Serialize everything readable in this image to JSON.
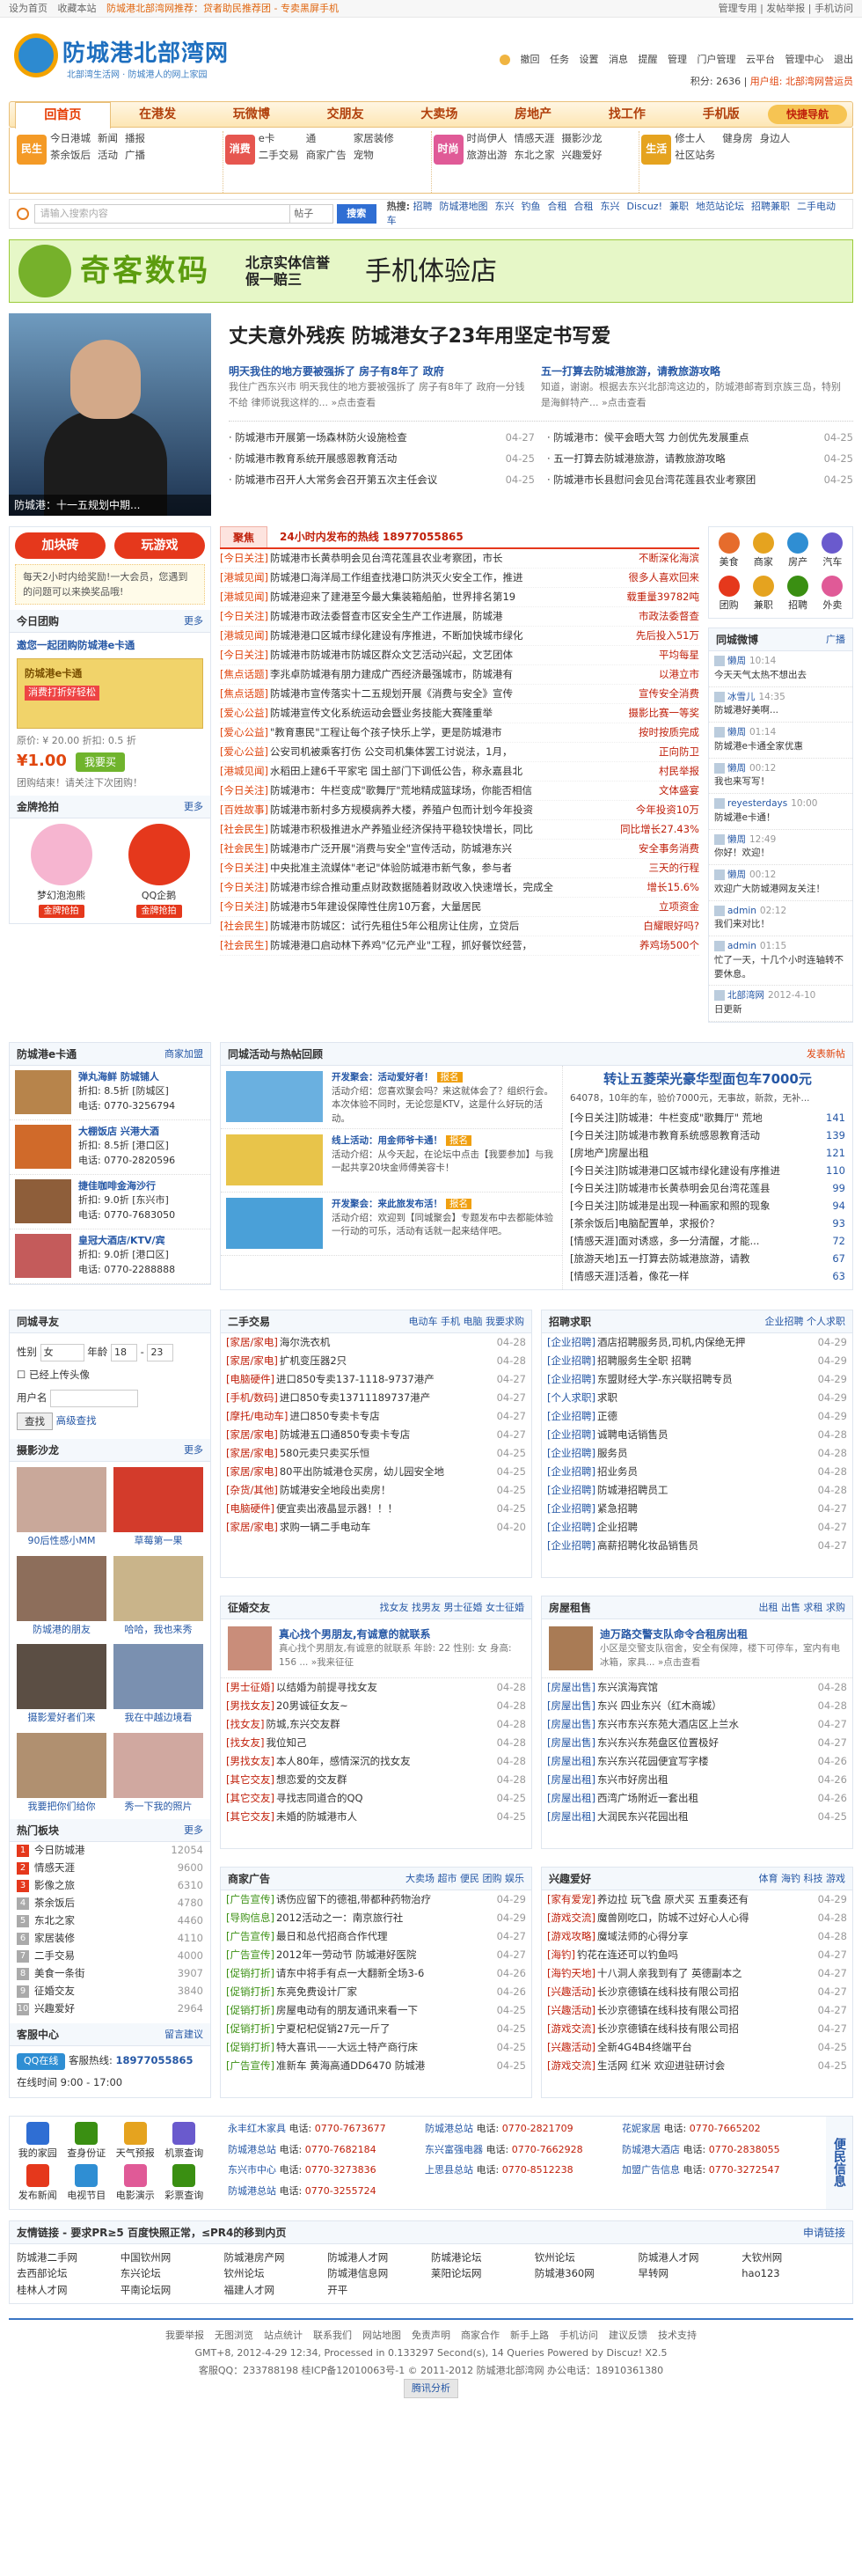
{
  "topbar": {
    "left": [
      "设为首页",
      "收藏本站"
    ],
    "notice": "防城港北部湾网推荐：贷者助民推荐团 - 专卖黑屏手机",
    "right": [
      "管理专用",
      "发帖举报",
      "手机访问"
    ]
  },
  "site": {
    "name": "防城港北部湾网",
    "slogan": "北部湾生活网 · 防城港人的网上家园"
  },
  "user": {
    "links": [
      "撤回",
      "任务",
      "设置",
      "消息",
      "提醒",
      "管理",
      "门户管理",
      "云平台",
      "管理中心",
      "退出"
    ],
    "score": "积分: 2636",
    "group": "用户组: 北部湾网营运员",
    "name": "撤回"
  },
  "nav": {
    "items": [
      "回首页",
      "在港发",
      "玩微博",
      "交朋友",
      "大卖场",
      "房地产",
      "找工作",
      "手机版"
    ],
    "right": "快捷导航"
  },
  "subnav": [
    {
      "icon": "民生",
      "color": "#f49a26",
      "links": [
        "今日港城",
        "新闻",
        "播报",
        "茶余饭后",
        "活动",
        "广播"
      ]
    },
    {
      "icon": "消费",
      "color": "#e6564f",
      "links": [
        "e卡",
        "通",
        "家居装修",
        "二手交易",
        "商家广告",
        "宠物"
      ]
    },
    {
      "icon": "时尚",
      "color": "#e05a97",
      "links": [
        "时尚伊人",
        "情感天涯",
        "摄影沙龙",
        "旅游出游",
        "东北之家",
        "兴趣爱好"
      ]
    },
    {
      "icon": "生活",
      "color": "#e5a31f",
      "links": [
        "修士人",
        "健身房",
        "身边人",
        "社区站务"
      ]
    }
  ],
  "search": {
    "placeholder": "请输入搜索内容",
    "scope": "帖子",
    "button": "搜索",
    "hotLabel": "热搜:",
    "hot": [
      "招聘",
      "防城港地图",
      "东兴",
      "钓鱼",
      "合租",
      "合租",
      "东兴",
      "Discuz!",
      "兼职",
      "地范站论坛",
      "招聘兼职",
      "二手电动车"
    ]
  },
  "banner": {
    "brand": "奇客数码",
    "mid1": "北京实体信誉",
    "mid2": "假一赔三",
    "right": "手机体验店"
  },
  "headline": {
    "caption": "防城港：十一五规划中期...",
    "title": "丈夫意外残疾 防城港女子23年用坚定书写爱",
    "p1t": "明天我住的地方要被强拆了 房子有8年了 政府",
    "p1": "我住广西东兴市 明天我住的地方要被强拆了 房子有8年了 政府一分钱不给 律师说我这样的... »点击查看",
    "p2t": "五一打算去防城港旅游，请教旅游攻略",
    "p2": "知道，谢谢。根据去东兴北部湾这边的，防城港邮寄到京族三岛，特别是海鲜特产... »点击查看",
    "news": [
      {
        "t": "防城港市开展第一场森林防火设施检查",
        "d": "04-27"
      },
      {
        "t": "防城港市：侯平会晤大驾 力创优先发展重点",
        "d": "04-25"
      },
      {
        "t": "防城港市教育系统开展感恩教育活动",
        "d": "04-25"
      },
      {
        "t": "五一打算去防城港旅游，请教旅游攻略",
        "d": "04-25"
      },
      {
        "t": "防城港市召开人大常务会召开第五次主任会议",
        "d": "04-25"
      },
      {
        "t": "防城港市长县慰问会见台湾花莲县农业考察团",
        "d": "04-25"
      }
    ]
  },
  "left": {
    "buttons": [
      "加块砖",
      "玩游戏"
    ],
    "notice": "每天2小时内给奖励!一大会员，您遇到的问题可以来换奖品哦!",
    "tgTitle": "今日团购",
    "tgItem": "邀您一起团购防城港e卡通",
    "tgCard": "防城港e卡通",
    "tgBadge": "消费打折好轻松",
    "tgPrice": "¥1.00",
    "tgOrig": "原价: ¥ 20.00  折扣: 0.5 折",
    "tgBuy": "我要买",
    "tgNote": "团购结束！请关注下次团购！",
    "giftTitle": "金牌抢拍",
    "gifts": [
      {
        "name": "梦幻泡泡熊",
        "btn": "金牌抢拍"
      },
      {
        "name": "QQ企鹅",
        "btn": "金牌抢拍"
      }
    ]
  },
  "center": {
    "tabs": [
      "聚焦",
      "24小时内发布的热线 18977055865"
    ],
    "list": [
      {
        "tag": "[今日关注]",
        "t": "防城港市长黄恭明会见台湾花莲县农业考察团，市长",
        "r": "不断深化海滨"
      },
      {
        "tag": "[港城见闻]",
        "t": "防城港口海洋局工作组查找港口防洪灭火安全工作，推进",
        "r": "很多人喜欢回来"
      },
      {
        "tag": "[港城见闻]",
        "t": "防城港迎来了建港至今最大集装箱船舶，世界排名第19",
        "r": "载重量39782吨"
      },
      {
        "tag": "[今日关注]",
        "t": "防城港市政法委督查市区安全生产工作进展，防城港",
        "r": "市政法委督查"
      },
      {
        "tag": "[港城见闻]",
        "t": "防城港港口区城市绿化建设有序推进，不断加快城市绿化",
        "r": "先后投入51万"
      },
      {
        "tag": "[今日关注]",
        "t": "防城港市防城港市防城区群众文艺活动兴起，文艺团体",
        "r": "平均每星"
      },
      {
        "tag": "[焦点话题]",
        "t": "李兆卓防城港有朋力建成广西经济最强城市，防城港有",
        "r": "以港立市"
      },
      {
        "tag": "[焦点话题]",
        "t": "防城港市宣传落实十二五规划开展《消费与安全》宣传",
        "r": "宣传安全消费"
      },
      {
        "tag": "[爱心公益]",
        "t": "防城港宣传文化系统运动会暨业务技能大赛隆重举",
        "r": "摄影比赛一等奖"
      },
      {
        "tag": "[爱心公益]",
        "t": "\"教育惠民\"工程让每个孩子快乐上学，更是防城港市",
        "r": "按时按质完成"
      },
      {
        "tag": "[爱心公益]",
        "t": "公安司机被乘客打伤 公交司机集体罢工讨说法，1月，",
        "r": "正向防卫"
      },
      {
        "tag": "[港城见闻]",
        "t": "水稻田上建6千平家宅 国土部门下调低公告，称永嘉县北",
        "r": "村民举报"
      },
      {
        "tag": "[今日关注]",
        "t": "防城港市：牛栏变成\"歌舞厅\"荒地精成篮球场，你能否相信",
        "r": "文体盛宴"
      },
      {
        "tag": "[百姓故事]",
        "t": "防城港市新村多方规模病养大楼，养殖户包而计划今年投资",
        "r": "今年投资10万"
      },
      {
        "tag": "[社会民生]",
        "t": "防城港市积极推进水产养殖业经济保持平稳较快增长，同比",
        "r": "同比增长27.43%"
      },
      {
        "tag": "[社会民生]",
        "t": "防城港市广泛开展\"消费与安全\"宣传活动，防城港东兴",
        "r": "安全事务消费"
      },
      {
        "tag": "[今日关注]",
        "t": "中央批准主流媒体\"老记\"体验防城港市新气象，参与者",
        "r": "三天的行程"
      },
      {
        "tag": "[今日关注]",
        "t": "防城港市综合推动重点财政数据随着财政收入快速增长，完成全",
        "r": "增长15.6%"
      },
      {
        "tag": "[今日关注]",
        "t": "防城港市5年建设保障性住房10万套，大量居民",
        "r": "立项资金"
      },
      {
        "tag": "[社会民生]",
        "t": "防城港市防城区：试行先租住5年公租房让住房，立贷后",
        "r": "白耀眼好吗?"
      },
      {
        "tag": "[社会民生]",
        "t": "防城港港口启动林下养鸡\"亿元产业\"工程，抓好餐饮经营，",
        "r": "养鸡场500个"
      }
    ]
  },
  "right": {
    "cats": [
      "美食",
      "商家",
      "房产",
      "汽车",
      "团购",
      "兼职",
      "招聘",
      "外卖"
    ],
    "catColors": [
      "#e66c2c",
      "#e5a31f",
      "#2f8ed3",
      "#6a5acd",
      "#e5381c",
      "#e5a31f",
      "#3a8f12",
      "#e05a97"
    ],
    "feedTitle": "同城微博",
    "feedMore": "广播",
    "feed": [
      {
        "who": "懒周",
        "tm": "10:14",
        "t": "今天天气太热不想出去"
      },
      {
        "who": "冰雪儿",
        "tm": "14:35",
        "t": "防城港好美啊..."
      },
      {
        "who": "懒周",
        "tm": "01:14",
        "t": "防城港e卡通全家优惠"
      },
      {
        "who": "懒周",
        "tm": "00:12",
        "t": "我也来写写！"
      },
      {
        "who": "reyesterdays",
        "tm": "10:00",
        "t": "防城港e卡通！"
      },
      {
        "who": "懒周",
        "tm": "12:49",
        "t": "你好！欢迎！"
      },
      {
        "who": "懒周",
        "tm": "00:12",
        "t": "欢迎广大防城港网友关注！"
      },
      {
        "who": "admin",
        "tm": "02:12",
        "t": "我们来对比！"
      },
      {
        "who": "admin",
        "tm": "01:15",
        "t": "忙了一天，十几个小时连轴转不要休息。"
      },
      {
        "who": "北部湾网",
        "tm": "2012-4-10",
        "t": "日更新"
      }
    ]
  },
  "merch": {
    "title": "防城港e卡通",
    "more": "商家加盟",
    "items": [
      {
        "n": "弹丸海鲜 防城铺人",
        "d": "折扣: 8.5折 [防城区]",
        "p": "电话: 0770-3256794"
      },
      {
        "n": "大棚饭店 兴港大酒",
        "d": "折扣: 8.5折 [港口区]",
        "p": "电话: 0770-2820596"
      },
      {
        "n": "捷佳咖啡金海沙行",
        "d": "折扣: 9.0折 [东兴市]",
        "p": "电话: 0770-7683050"
      },
      {
        "n": "皇冠大酒店/KTV/宾",
        "d": "折扣: 9.0折 [港口区]",
        "p": "电话: 0770-2288888"
      }
    ]
  },
  "activity": {
    "title": "同城活动与热帖回顾",
    "more": "发表新帖",
    "items": [
      {
        "n": "开发聚会：活动爱好者！",
        "tag": "报名",
        "d": "活动介绍：您喜欢聚会吗？来这就体会了？组织行会。本次体验不同时，无论您是KTV，这是什么好玩的活动。"
      },
      {
        "n": "线上活动：用金师爷卡通！",
        "tag": "报名",
        "d": "活动介绍：从今天起，在论坛中点击【我要参加】与我一起共享20块金师傅美容卡！"
      },
      {
        "n": "开发聚会：来此旅发布活！",
        "tag": "报名",
        "d": "活动介绍：欢迎到【同城聚会】专题发布中去都能体验一行动的可乐，活动有话就一起来结伴吧。"
      }
    ],
    "hotTitle": "转让五菱荣光豪华型面包车7000元",
    "hotP": "64078，10年的车，验价7000元，无事故，新款，无补...",
    "hot": [
      {
        "t": "[今日关注]防城港：牛栏变成\"歌舞厅\" 荒地",
        "c": "141"
      },
      {
        "t": "[今日关注]防城港市教育系统感恩教育活动",
        "c": "139"
      },
      {
        "t": "[房地产]房屋出租",
        "c": "121"
      },
      {
        "t": "[今日关注]防城港港口区城市绿化建设有序推进",
        "c": "110"
      },
      {
        "t": "[今日关注]防城港市长黄恭明会见台湾花莲县",
        "c": "99"
      },
      {
        "t": "[今日关注]防城港是出现一种画家和照的现象",
        "c": "94"
      },
      {
        "t": "[茶余饭后]电脑配置单，求报价？",
        "c": "93"
      },
      {
        "t": "[情感天涯]面对诱惑，多一分清醒，才能...",
        "c": "72"
      },
      {
        "t": "[旅游天地]五一打算去防城港旅游，请教",
        "c": "67"
      },
      {
        "t": "[情感天涯]活着，像花一样",
        "c": "63"
      }
    ]
  },
  "finder": {
    "title": "同城寻友",
    "sex": "女",
    "age1": "18",
    "age2": "23",
    "photo": "已经上传头像",
    "user": "用户名",
    "btn": "查找",
    "adv": "高级查找"
  },
  "photos": {
    "title": "摄影沙龙",
    "more": "更多",
    "items": [
      "90后性感小MM",
      "草莓第一果",
      "防城港的朋友",
      "哈哈，我也来秀",
      "摄影爱好者们来",
      "我在中越边境看",
      "我要把你们给你",
      "秀一下我的照片"
    ]
  },
  "hotboard": {
    "title": "热门板块",
    "items": [
      {
        "n": "今日防城港",
        "c": "12054"
      },
      {
        "n": "情感天涯",
        "c": "9600"
      },
      {
        "n": "影像之旅",
        "c": "6310"
      },
      {
        "n": "茶余饭后",
        "c": "4780"
      },
      {
        "n": "东北之家",
        "c": "4460"
      },
      {
        "n": "家居装修",
        "c": "4110"
      },
      {
        "n": "二手交易",
        "c": "4000"
      },
      {
        "n": "美食一条街",
        "c": "3907"
      },
      {
        "n": "征婚交友",
        "c": "3840"
      },
      {
        "n": "兴趣爱好",
        "c": "2964"
      }
    ]
  },
  "ershou": {
    "title": "二手交易",
    "tabs": [
      "电动车",
      "手机",
      "电脑",
      "我要求购"
    ],
    "items": [
      {
        "tag": "[家居/家电]",
        "t": "海尔洗衣机",
        "d": "04-28"
      },
      {
        "tag": "[家居/家电]",
        "t": "扩机变压器2只",
        "d": "04-28"
      },
      {
        "tag": "[电脑硬件]",
        "t": "进口850专卖137-1118-9737港产",
        "d": "04-27"
      },
      {
        "tag": "[手机/数码]",
        "t": "进口850专卖13711189737港产",
        "d": "04-27"
      },
      {
        "tag": "[摩托/电动车]",
        "t": "进口850专卖卡专店",
        "d": "04-27"
      },
      {
        "tag": "[家居/家电]",
        "t": "防城港五口通850专卖卡专店",
        "d": "04-27"
      },
      {
        "tag": "[家居/家电]",
        "t": "580元卖只卖买乐恒",
        "d": "04-25"
      },
      {
        "tag": "[家居/家电]",
        "t": "80平出防城港仓买房，幼儿园安全地",
        "d": "04-25"
      },
      {
        "tag": "[杂货/其他]",
        "t": "防城港安全地段出卖房！",
        "d": "04-25"
      },
      {
        "tag": "[电脑硬件]",
        "t": "便宜卖出液晶显示器！！！",
        "d": "04-25"
      },
      {
        "tag": "[家居/家电]",
        "t": "求购一辆二手电动车",
        "d": "04-20"
      }
    ]
  },
  "zhaopin": {
    "title": "招聘求职",
    "tabs": [
      "企业招聘",
      "个人求职"
    ],
    "items": [
      {
        "tag": "[企业招聘]",
        "t": "酒店招聘服务员,司机,内保绝无押",
        "d": "04-29"
      },
      {
        "tag": "[企业招聘]",
        "t": "招聘服务生全职 招聘",
        "d": "04-29"
      },
      {
        "tag": "[企业招聘]",
        "t": "东盟财经大学-东兴联招聘专员",
        "d": "04-29"
      },
      {
        "tag": "[个人求职]",
        "t": "求职",
        "d": "04-29"
      },
      {
        "tag": "[企业招聘]",
        "t": "正德",
        "d": "04-29"
      },
      {
        "tag": "[企业招聘]",
        "t": "诚聘电话销售员",
        "d": "04-28"
      },
      {
        "tag": "[企业招聘]",
        "t": "服务员",
        "d": "04-28"
      },
      {
        "tag": "[企业招聘]",
        "t": "招业务员",
        "d": "04-28"
      },
      {
        "tag": "[企业招聘]",
        "t": "防城港招聘员工",
        "d": "04-28"
      },
      {
        "tag": "[企业招聘]",
        "t": "紧急招聘",
        "d": "04-27"
      },
      {
        "tag": "[企业招聘]",
        "t": "企业招聘",
        "d": "04-27"
      },
      {
        "tag": "[企业招聘]",
        "t": "高薪招聘化妆品销售员",
        "d": "04-27"
      }
    ]
  },
  "zhenghun": {
    "title": "征婚交友",
    "tabs": [
      "找女友",
      "找男友",
      "男士征婚",
      "女士征婚"
    ],
    "feat": "真心找个男朋友,有诚意的就联系",
    "featP": "真心找个男朋友,有诚意的就联系 年龄: 22 性别: 女 身高: 156 ... »我来征征",
    "items": [
      {
        "tag": "[男士征婚]",
        "t": "以结婚为前提寻找女友",
        "d": "04-28"
      },
      {
        "tag": "[男找女友]",
        "t": "20男诚征女友~",
        "d": "04-28"
      },
      {
        "tag": "[找女友]",
        "t": "防城,东兴交友群",
        "d": "04-28"
      },
      {
        "tag": "[找女友]",
        "t": "我位知己",
        "d": "04-28"
      },
      {
        "tag": "[男找女友]",
        "t": "本人80年，感情深沉的找女友",
        "d": "04-28"
      },
      {
        "tag": "[其它交友]",
        "t": "想恋爱的交友群",
        "d": "04-28"
      },
      {
        "tag": "[其它交友]",
        "t": "寻找志同道合的QQ",
        "d": "04-25"
      },
      {
        "tag": "[其它交友]",
        "t": "未婚的防城港市人",
        "d": "04-25"
      }
    ]
  },
  "fang": {
    "title": "房屋租售",
    "tabs": [
      "出租",
      "出售",
      "求租",
      "求购"
    ],
    "feat": "迪万路交警支队命令合租房出租",
    "featP": "小区是交警支队宿舍，安全有保障，楼下可停车，室内有电冰箱，家具... »点击查看",
    "items": [
      {
        "tag": "[房屋出售]",
        "t": "东兴滨海宾馆",
        "d": "04-28"
      },
      {
        "tag": "[房屋出售]",
        "t": "东兴 四业东兴（红木商城）",
        "d": "04-28"
      },
      {
        "tag": "[房屋出售]",
        "t": "东兴市东兴东苑大酒店区上兰水",
        "d": "04-27"
      },
      {
        "tag": "[房屋出售]",
        "t": "东兴东兴东苑盘区位置极好",
        "d": "04-27"
      },
      {
        "tag": "[房屋出租]",
        "t": "东兴东兴花园便宜写字楼",
        "d": "04-26"
      },
      {
        "tag": "[房屋出租]",
        "t": "东兴市好房出租",
        "d": "04-26"
      },
      {
        "tag": "[房屋出租]",
        "t": "西湾广场附近一套出租",
        "d": "04-26"
      },
      {
        "tag": "[房屋出租]",
        "t": "大润民东兴花园出租",
        "d": "04-25"
      }
    ]
  },
  "shangjia": {
    "title": "商家广告",
    "tabs": [
      "大卖场",
      "超市",
      "便民",
      "团购",
      "娱乐"
    ],
    "items": [
      {
        "tag": "[广告宣传]",
        "t": "诱伤应留下的德祖,带都种药物治疗",
        "d": "04-29"
      },
      {
        "tag": "[导购信息]",
        "t": "2012活动之一：南京旅行社",
        "d": "04-29"
      },
      {
        "tag": "[广告宣传]",
        "t": "最日和总代招商合作代理",
        "d": "04-27"
      },
      {
        "tag": "[广告宣传]",
        "t": "2012年一劳动节 防城港好医院",
        "d": "04-27"
      },
      {
        "tag": "[促销打折]",
        "t": "请东中将手有点一大翻新全场3-6",
        "d": "04-26"
      },
      {
        "tag": "[促销打折]",
        "t": "东亮免费设计厂家",
        "d": "04-26"
      },
      {
        "tag": "[促销打折]",
        "t": "房屋电动有的朋友通讯来看一下",
        "d": "04-25"
      },
      {
        "tag": "[促销打折]",
        "t": "宁夏杞杞促销27元一斤了",
        "d": "04-25"
      },
      {
        "tag": "[促销打折]",
        "t": "特大喜讯——大远土特产商行床",
        "d": "04-25"
      },
      {
        "tag": "[广告宣传]",
        "t": "准新车 黄海高通DD6470 防城港",
        "d": "04-25"
      }
    ]
  },
  "xingqu": {
    "title": "兴趣爱好",
    "tabs": [
      "体育",
      "海钓",
      "科技",
      "游戏"
    ],
    "items": [
      {
        "tag": "[家有爱宠]",
        "t": "养边拉 玩飞盘 原犬买 五重奏还有",
        "d": "04-29"
      },
      {
        "tag": "[游戏交流]",
        "t": "魔兽刚吃口，防城不过好心人心得",
        "d": "04-28"
      },
      {
        "tag": "[游戏攻略]",
        "t": "魔域法师的心得分享",
        "d": "04-28"
      },
      {
        "tag": "[海钓]",
        "t": "钓花在连还可以钓鱼吗",
        "d": "04-27"
      },
      {
        "tag": "[海钓天地]",
        "t": "十八洞人亲我到有了 英德副本之",
        "d": "04-27"
      },
      {
        "tag": "[兴趣活动]",
        "t": "长沙京德镇在线科技有限公司招",
        "d": "04-27"
      },
      {
        "tag": "[兴趣活动]",
        "t": "长沙京德镇在线科技有限公司招",
        "d": "04-27"
      },
      {
        "tag": "[游戏交流]",
        "t": "长沙京德镇在线科技有限公司招",
        "d": "04-27"
      },
      {
        "tag": "[兴趣活动]",
        "t": "全新4G4B4终端平台",
        "d": "04-25"
      },
      {
        "tag": "[游戏交流]",
        "t": "生活网 红米 欢迎进驻研讨会",
        "d": "04-25"
      }
    ]
  },
  "kefu": {
    "title": "客服中心",
    "more": "留言建议",
    "qq": "QQ在线",
    "phoneLabel": "客服热线:",
    "phone": "18977055865",
    "online": "在线时间 9:00 - 17:00"
  },
  "services": {
    "items": [
      "我的家园",
      "查身份证",
      "天气预报",
      "机票查询",
      "发布新闻",
      "电视节目",
      "电影演示",
      "彩票查询"
    ],
    "colors": [
      "#2f6ed3",
      "#3a8f12",
      "#e5a31f",
      "#6a5acd",
      "#e5381c",
      "#2f8ed3",
      "#e05a97",
      "#3a8f12"
    ]
  },
  "phones": [
    {
      "n": "永丰红木家具",
      "p": "0770-7673677"
    },
    {
      "n": "防城港总站",
      "p": "0770-2821709"
    },
    {
      "n": "花妮家居",
      "p": "0770-7665202"
    },
    {
      "n": "防城港总站",
      "p": "0770-7682184"
    },
    {
      "n": "东兴富强电器",
      "p": "0770-7662928"
    },
    {
      "n": "防城港大酒店",
      "p": "0770-2838055"
    },
    {
      "n": "东兴市中心",
      "p": "0770-3273836"
    },
    {
      "n": "上思县总站",
      "p": "0770-8512238"
    },
    {
      "n": "加盟广告信息",
      "p": "0770-3272547"
    },
    {
      "n": "防城港总站",
      "p": "0770-3255724"
    }
  ],
  "mobile": "便民信息",
  "friend": {
    "title": "友情链接 - 要求PR≥5 百度快照正常，≤PR4的移到内页",
    "more": "申请链接",
    "links": [
      "防城港二手网",
      "中国钦州网",
      "防城港房产网",
      "防城港人才网",
      "防城港论坛",
      "钦州论坛",
      "防城港人才网",
      "大钦州网",
      "去西部论坛",
      "东兴论坛",
      "钦州论坛",
      "防城港信息网",
      "莱阳论坛网",
      "防城港360网",
      "早转网",
      "hao123",
      "桂林人才网",
      "平南论坛网",
      "福建人才网",
      "开平"
    ]
  },
  "footer": {
    "links": [
      "我要举报",
      "无图浏览",
      "站点统计",
      "联系我们",
      "网站地图",
      "免责声明",
      "商家合作",
      "新手上路",
      "手机访问",
      "建议反馈",
      "技术支持"
    ],
    "line2": "GMT+8, 2012-4-29 12:34, Processed in 0.133297 Second(s), 14 Queries Powered by Discuz! X2.5",
    "line3": "客服QQ：233788198 桂ICP备12010063号-1 © 2011-2012 防城港北部湾网 办公电话：18910361380",
    "badge": "腾讯分析"
  }
}
